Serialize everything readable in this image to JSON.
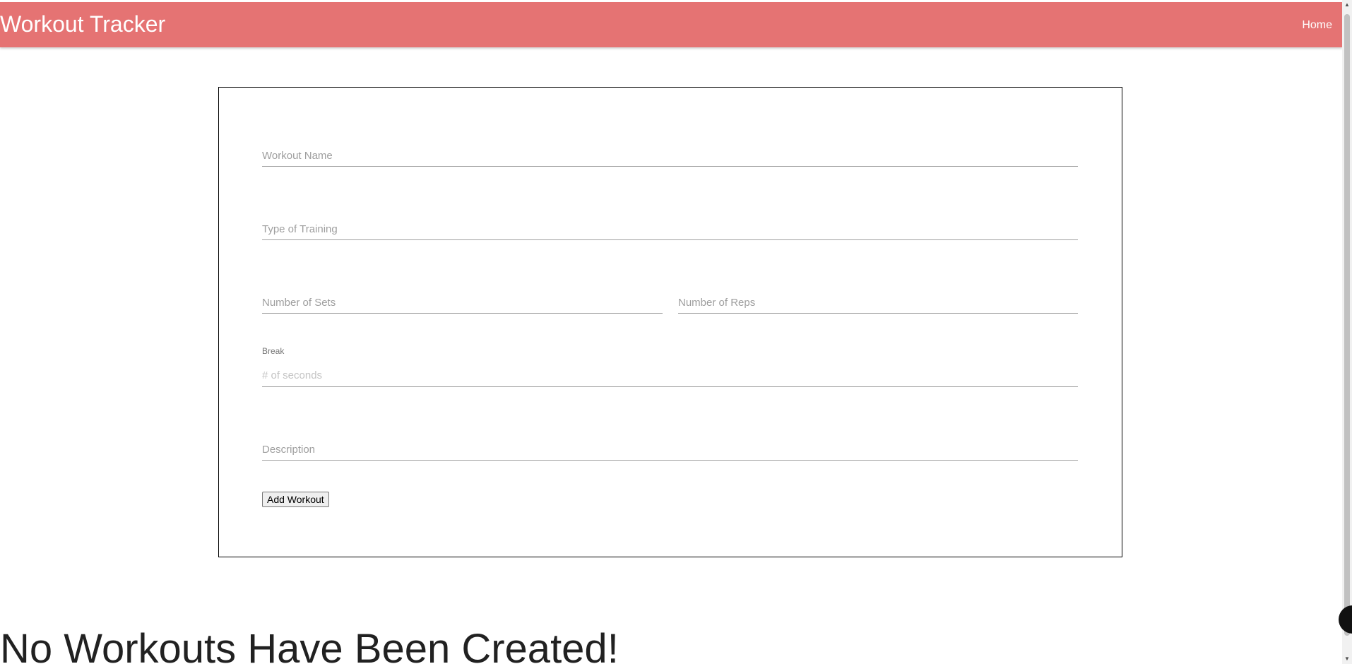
{
  "navbar": {
    "brand": "Workout Tracker",
    "home_link": "Home",
    "color": "#e57373"
  },
  "form": {
    "workout_name_label": "Workout Name",
    "training_type_label": "Type of Training",
    "sets_label": "Number of Sets",
    "reps_label": "Number of Reps",
    "break_label": "Break",
    "break_placeholder": "# of seconds",
    "description_label": "Description",
    "submit_label": "Add Workout"
  },
  "empty_state": {
    "heading": "No Workouts Have Been Created!"
  }
}
